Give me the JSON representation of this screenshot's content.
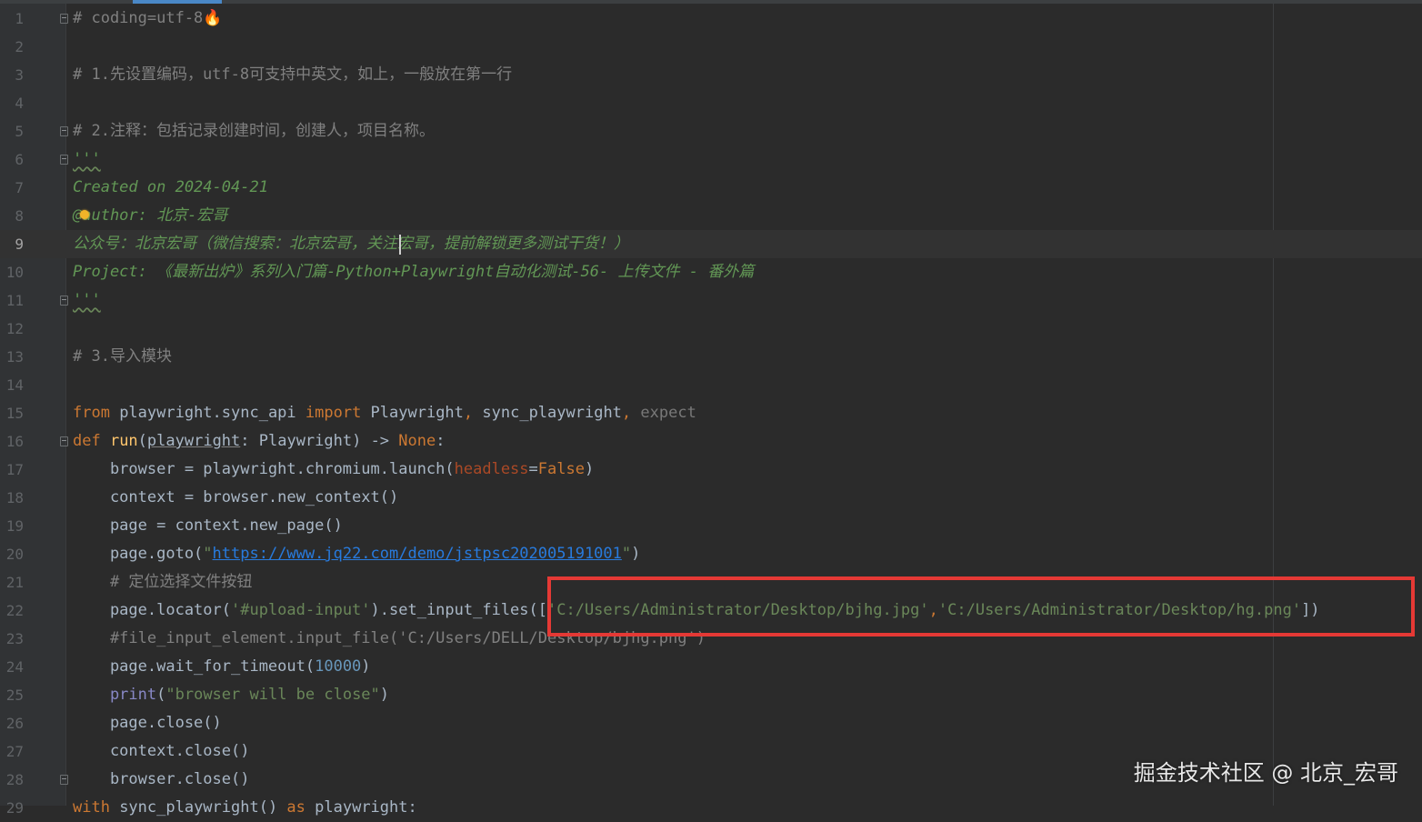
{
  "lines": [
    {
      "num": "1",
      "t": [
        {
          "c": "comment",
          "v": "# coding=utf-8"
        },
        {
          "c": "emoji",
          "v": "🔥"
        }
      ]
    },
    {
      "num": "2",
      "t": []
    },
    {
      "num": "3",
      "t": [
        {
          "c": "comment",
          "v": "# 1.先设置编码，utf-8可支持中英文，如上，一般放在第一行"
        }
      ]
    },
    {
      "num": "4",
      "t": []
    },
    {
      "num": "5",
      "t": [
        {
          "c": "comment",
          "v": "# 2.注释：包括记录创建时间，创建人，项目名称。"
        }
      ]
    },
    {
      "num": "6",
      "t": [
        {
          "c": "doc squig",
          "v": "'''"
        }
      ]
    },
    {
      "num": "7",
      "t": [
        {
          "c": "doc",
          "v": "Created on 2024-04-21"
        }
      ]
    },
    {
      "num": "8",
      "t": [
        {
          "c": "doc",
          "v": "@author: 北京-宏哥"
        }
      ]
    },
    {
      "num": "9",
      "t": [
        {
          "c": "doc",
          "v": "公众号：北京宏哥（微信搜索：北京宏哥，关注宏哥，提前解锁更多测试干货！）"
        }
      ]
    },
    {
      "num": "10",
      "t": [
        {
          "c": "doc",
          "v": "Project: 《最新出炉》系列入门篇-Python+Playwright自动化测试-56- 上传文件 - 番外篇"
        }
      ]
    },
    {
      "num": "11",
      "t": [
        {
          "c": "doc squig",
          "v": "'''"
        }
      ]
    },
    {
      "num": "12",
      "t": []
    },
    {
      "num": "13",
      "t": [
        {
          "c": "comment",
          "v": "# 3.导入模块"
        }
      ]
    },
    {
      "num": "14",
      "t": []
    },
    {
      "num": "15",
      "t": [
        {
          "c": "kw",
          "v": "from "
        },
        {
          "c": "",
          "v": "playwright.sync_api "
        },
        {
          "c": "kw",
          "v": "import "
        },
        {
          "c": "",
          "v": "Playwright"
        },
        {
          "c": "kw",
          "v": ", "
        },
        {
          "c": "",
          "v": "sync_playwright"
        },
        {
          "c": "kw",
          "v": ", "
        },
        {
          "c": "muted",
          "v": "expect"
        }
      ]
    },
    {
      "num": "16",
      "t": [
        {
          "c": "kw",
          "v": "def "
        },
        {
          "c": "fn",
          "v": "run"
        },
        {
          "c": "",
          "v": "("
        },
        {
          "c": "under",
          "v": "playwright"
        },
        {
          "c": "",
          "v": ": Playwright) -> "
        },
        {
          "c": "kw",
          "v": "None"
        },
        {
          "c": "",
          "v": ":"
        }
      ]
    },
    {
      "num": "17",
      "t": [
        {
          "c": "",
          "v": "    browser = playwright.chromium.launch("
        },
        {
          "c": "param",
          "v": "headless"
        },
        {
          "c": "",
          "v": "="
        },
        {
          "c": "kw",
          "v": "False"
        },
        {
          "c": "",
          "v": ")"
        }
      ]
    },
    {
      "num": "18",
      "t": [
        {
          "c": "",
          "v": "    context = browser.new_context()"
        }
      ]
    },
    {
      "num": "19",
      "t": [
        {
          "c": "",
          "v": "    page = context.new_page()"
        }
      ]
    },
    {
      "num": "20",
      "t": [
        {
          "c": "",
          "v": "    page.goto("
        },
        {
          "c": "str",
          "v": "\""
        },
        {
          "c": "url",
          "v": "https://www.jq22.com/demo/jstpsc202005191001"
        },
        {
          "c": "str",
          "v": "\""
        },
        {
          "c": "",
          "v": ")"
        }
      ]
    },
    {
      "num": "21",
      "t": [
        {
          "c": "comment",
          "v": "    # 定位选择文件按钮"
        }
      ]
    },
    {
      "num": "22",
      "t": [
        {
          "c": "",
          "v": "    page.locator("
        },
        {
          "c": "str",
          "v": "'#upload-input'"
        },
        {
          "c": "",
          "v": ").set_input_files(["
        },
        {
          "c": "str",
          "v": "'C:/Users/Administrator/Desktop/bjhg.jpg'"
        },
        {
          "c": "kw",
          "v": ","
        },
        {
          "c": "str",
          "v": "'C:/Users/Administrator/Desktop/hg.png'"
        },
        {
          "c": "",
          "v": "])"
        }
      ]
    },
    {
      "num": "23",
      "t": [
        {
          "c": "comment",
          "v": "    #file_input_element.input_file('C:/Users/DELL/Desktop/bjhg.png')"
        }
      ]
    },
    {
      "num": "24",
      "t": [
        {
          "c": "",
          "v": "    page.wait_for_timeout("
        },
        {
          "c": "num",
          "v": "10000"
        },
        {
          "c": "",
          "v": ")"
        }
      ]
    },
    {
      "num": "25",
      "t": [
        {
          "c": "builtin",
          "v": "    print"
        },
        {
          "c": "",
          "v": "("
        },
        {
          "c": "str",
          "v": "\"browser will be close\""
        },
        {
          "c": "",
          "v": ")"
        }
      ]
    },
    {
      "num": "26",
      "t": [
        {
          "c": "",
          "v": "    page.close()"
        }
      ]
    },
    {
      "num": "27",
      "t": [
        {
          "c": "",
          "v": "    context.close()"
        }
      ]
    },
    {
      "num": "28",
      "t": [
        {
          "c": "",
          "v": "    browser.close()"
        }
      ]
    },
    {
      "num": "29",
      "t": [
        {
          "c": "kw",
          "v": "with "
        },
        {
          "c": "",
          "v": "sync_playwright() "
        },
        {
          "c": "kw",
          "v": "as "
        },
        {
          "c": "",
          "v": "playwright:"
        }
      ]
    }
  ],
  "current_line": "9",
  "watermark": "掘金技术社区 @ 北京_宏哥",
  "colors": {
    "background": "#2b2b2b",
    "comment": "#808080",
    "docstring": "#629755",
    "keyword": "#cc7832",
    "string": "#6a8759",
    "highlight_box": "#e53935"
  }
}
